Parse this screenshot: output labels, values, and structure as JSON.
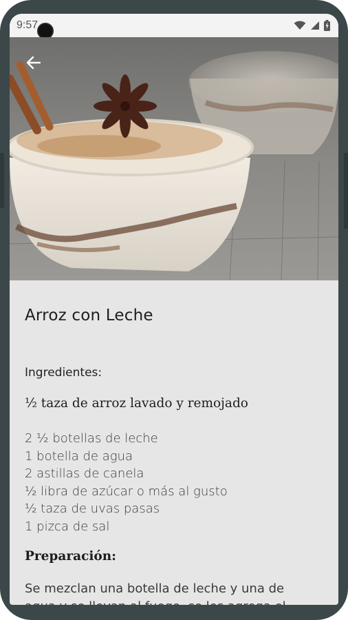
{
  "status_bar": {
    "time": "9:57",
    "icons": [
      "wifi-icon",
      "signal-icon",
      "battery-icon"
    ]
  },
  "toolbar": {
    "back_icon": "arrow-left-icon"
  },
  "hero_image": {
    "description": "recipe photo"
  },
  "recipe": {
    "title": "Arroz con Leche",
    "ingredients_heading": "Ingredientes:",
    "first_ingredient": "½ taza de arroz lavado y remojado",
    "ingredients": [
      "2 ½ botellas de leche",
      "1 botella de agua",
      "2 astillas de canela",
      "½ libra de azúcar o más al gusto",
      "½ taza de uvas pasas",
      "1 pizca de sal"
    ],
    "preparation_heading": "Preparación:",
    "preparation_text": "Se mezclan una botella de leche y una de agua y se llevan al fuego, se les agrega el"
  },
  "colors": {
    "frame": "#3c474a",
    "screen_bg": "#e6e6e6",
    "status_bg": "#f3f3f3"
  }
}
